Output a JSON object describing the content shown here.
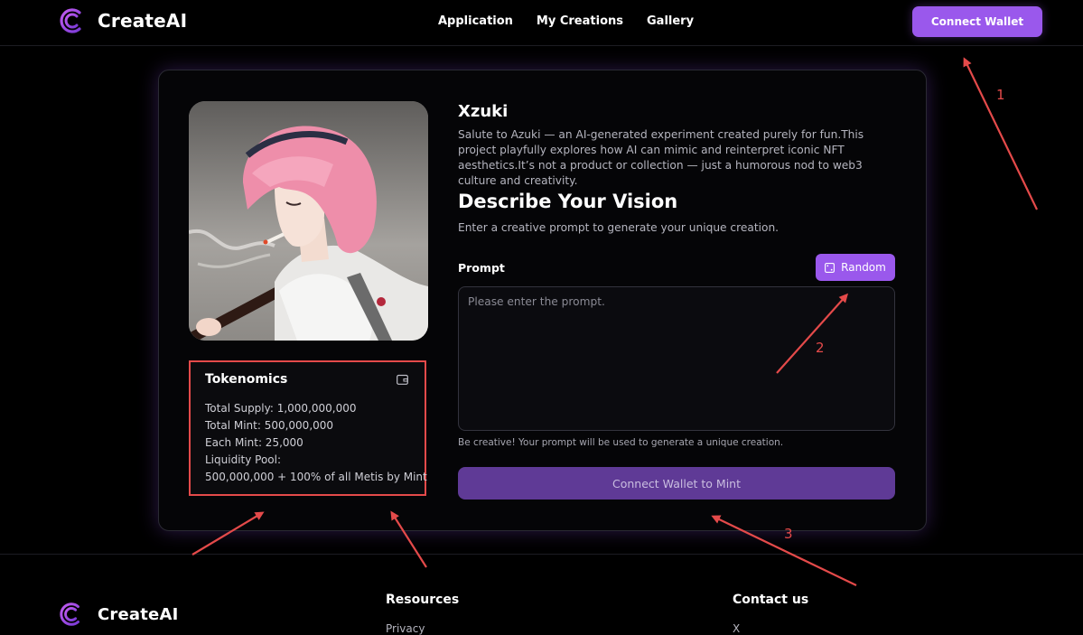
{
  "brand": {
    "name": "CreateAI"
  },
  "nav": {
    "items": [
      "Application",
      "My Creations",
      "Gallery"
    ]
  },
  "header": {
    "connect_wallet": "Connect Wallet"
  },
  "tokenomics": {
    "title": "Tokenomics",
    "lines": [
      "Total Supply: 1,000,000,000",
      "Total Mint: 500,000,000",
      "Each Mint: 25,000",
      "Liquidity Pool:",
      "500,000,000 + 100% of all Metis by Mint"
    ]
  },
  "project": {
    "title": "Xzuki",
    "description": "Salute to Azuki — an AI-generated experiment created purely for fun.This project playfully explores how AI can mimic and reinterpret iconic NFT aesthetics.It’s not a product or collection — just a humorous nod to web3 culture and creativity."
  },
  "vision": {
    "title": "Describe Your Vision",
    "subtitle": "Enter a creative prompt to generate your unique creation.",
    "prompt_label": "Prompt",
    "random_label": "Random",
    "prompt_value": "",
    "prompt_placeholder": "Please enter the prompt.",
    "hint": "Be creative! Your prompt will be used to generate a unique creation.",
    "mint_button": "Connect Wallet to Mint"
  },
  "footer": {
    "brand": "CreateAI",
    "resources_title": "Resources",
    "resources_item": "Privacy",
    "contact_title": "Contact us",
    "contact_item": "X"
  },
  "annotations": {
    "labels": [
      "1",
      "2",
      "3"
    ]
  },
  "colors": {
    "accent": "#9a58ec",
    "mint_button": "#5f3a96",
    "annotation": "#e44a4a",
    "background": "#000000"
  },
  "icons": [
    "logo-icon",
    "wallet-icon",
    "shuffle-icon"
  ]
}
